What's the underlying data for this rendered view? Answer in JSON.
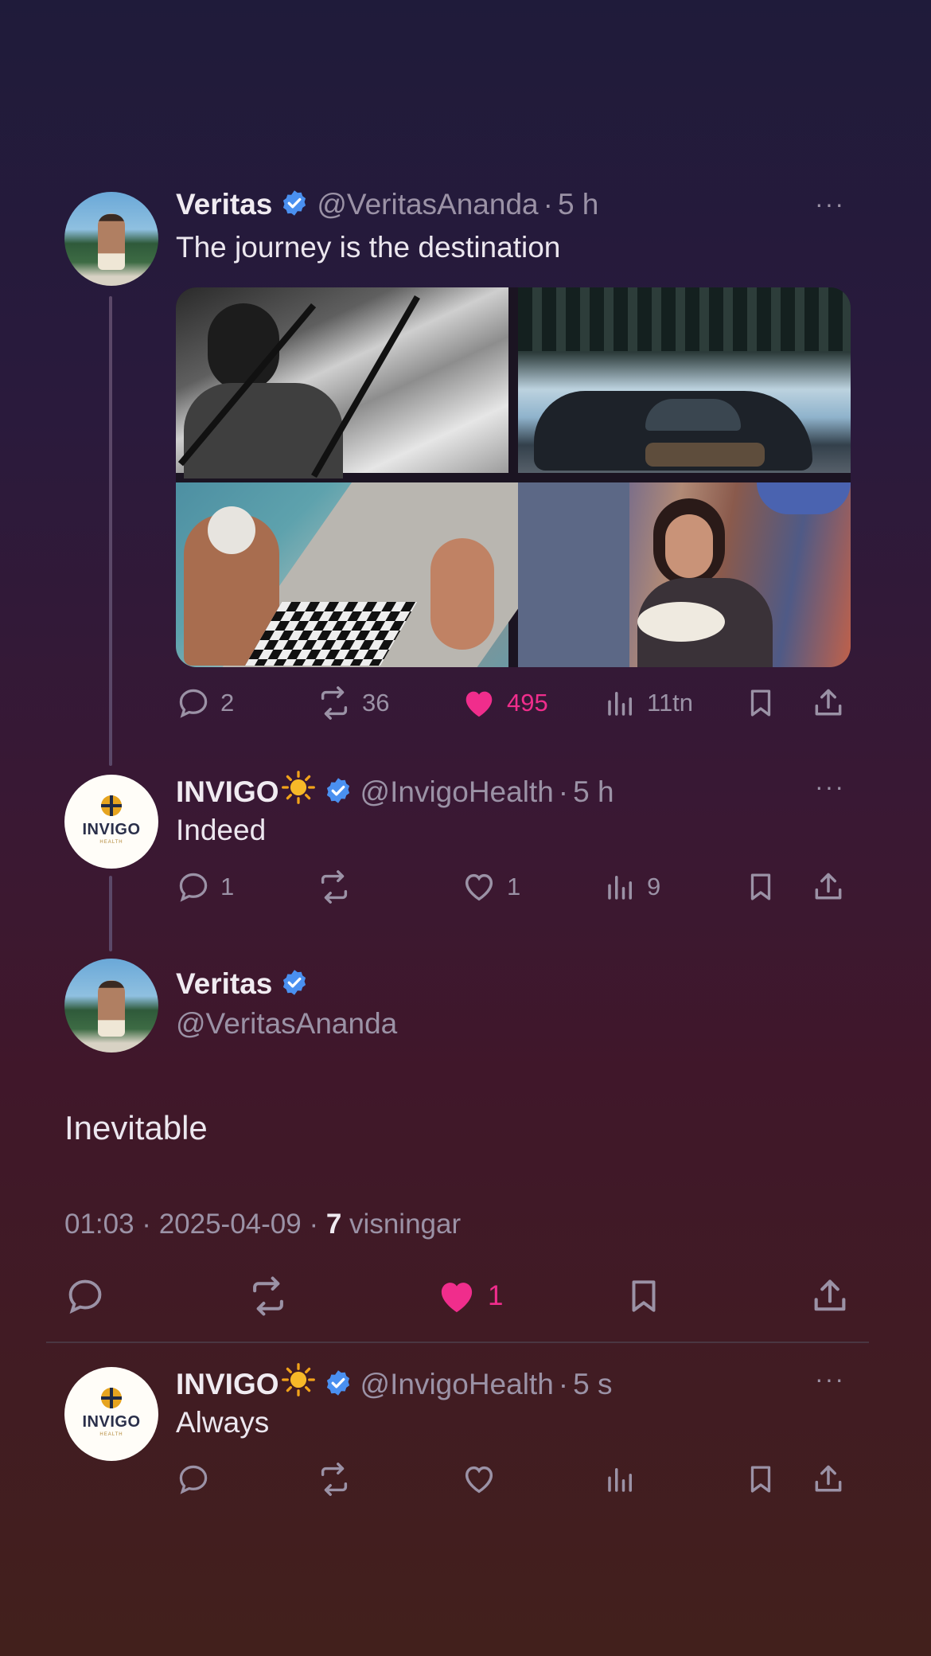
{
  "colors": {
    "accent_pink": "#f02d8c",
    "verified_blue": "#4a90f0",
    "muted": "#9b92a6"
  },
  "post1": {
    "author": "Veritas",
    "handle": "@VeritasAnanda",
    "time": "5 h",
    "text": "The journey is the destination",
    "media_alt": [
      "man-with-pipe-fishing-photo",
      "sports-car-in-snow-photo",
      "chess-by-pool-photo",
      "woman-eating-spaghetti-photo"
    ],
    "replies": "2",
    "reposts": "36",
    "likes": "495",
    "views": "11tn"
  },
  "post2": {
    "author": "INVIGO",
    "handle": "@InvigoHealth",
    "time": "5 h",
    "text": "Indeed",
    "replies": "1",
    "likes": "1",
    "views": "9"
  },
  "main_post": {
    "author": "Veritas",
    "handle": "@VeritasAnanda",
    "text": "Inevitable",
    "timestamp": "01:03 · 2025-04-09 ·",
    "views_count": "7",
    "views_label": "visningar",
    "likes": "1"
  },
  "reply": {
    "author": "INVIGO",
    "handle": "@InvigoHealth",
    "time": "5 s",
    "text": "Always"
  },
  "avatar_text": {
    "brand": "INVIGO",
    "sub": "HEALTH"
  },
  "sep": "·",
  "more": "···"
}
